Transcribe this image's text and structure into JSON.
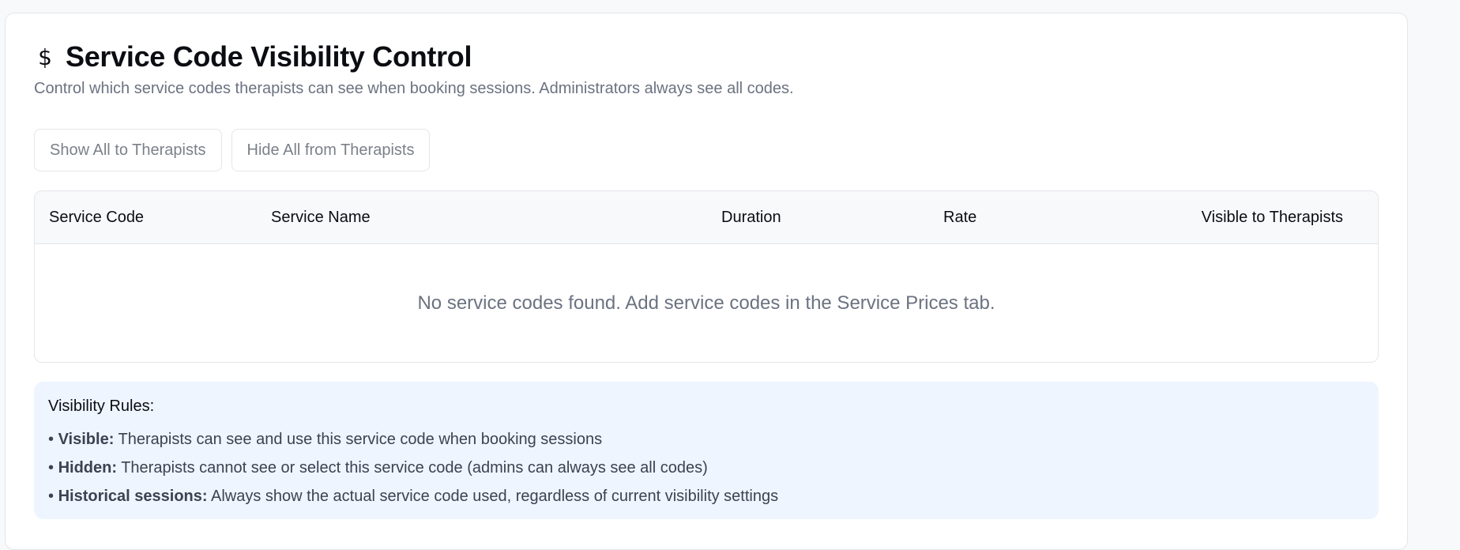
{
  "page": {
    "title": "Service Code Visibility Control",
    "subtitle": "Control which service codes therapists can see when booking sessions. Administrators always see all codes.",
    "icon": "dollar-icon"
  },
  "actions": {
    "show_all_label": "Show All to Therapists",
    "hide_all_label": "Hide All from Therapists"
  },
  "table": {
    "columns": [
      "Service Code",
      "Service Name",
      "Duration",
      "Rate",
      "Visible to Therapists"
    ],
    "rows": [],
    "empty_message": "No service codes found. Add service codes in the Service Prices tab."
  },
  "rules": {
    "title": "Visibility Rules:",
    "items": [
      {
        "bullet": "•",
        "term": "Visible:",
        "text": " Therapists can see and use this service code when booking sessions"
      },
      {
        "bullet": "•",
        "term": "Hidden:",
        "text": " Therapists cannot see or select this service code (admins can always see all codes)"
      },
      {
        "bullet": "•",
        "term": "Historical sessions:",
        "text": " Always show the actual service code used, regardless of current visibility settings"
      }
    ]
  },
  "colors": {
    "rules_background": "#eef5ff",
    "muted_text": "#6b7280",
    "border": "#e3e6ea"
  }
}
